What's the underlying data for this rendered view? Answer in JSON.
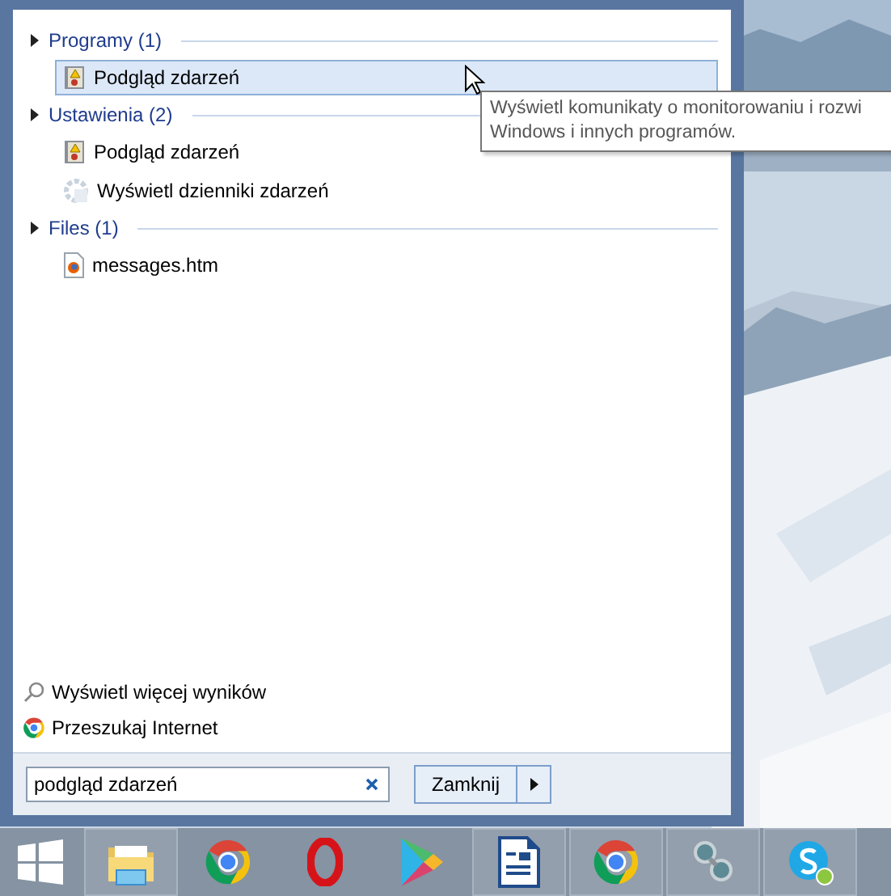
{
  "groups": [
    {
      "title": "Programy (1)",
      "items": [
        {
          "label": "Podgląd zdarzeń",
          "kind": "event-viewer",
          "selected": true
        }
      ]
    },
    {
      "title": "Ustawienia (2)",
      "items": [
        {
          "label": "Podgląd zdarzeń",
          "kind": "event-viewer",
          "selected": false
        },
        {
          "label": "Wyświetl dzienniki zdarzeń",
          "kind": "settings",
          "selected": false
        }
      ]
    },
    {
      "title": "Files (1)",
      "items": [
        {
          "label": "messages.htm",
          "kind": "html-file",
          "selected": false
        }
      ]
    }
  ],
  "tooltip": {
    "lines": [
      "Wyświetl komunikaty o monitorowaniu i rozwi",
      "Windows i innych programów."
    ]
  },
  "links": [
    {
      "label": "Wyświetl więcej wyników",
      "kind": "search"
    },
    {
      "label": "Przeszukaj Internet",
      "kind": "browser"
    }
  ],
  "search": {
    "value": "podgląd zdarzeń"
  },
  "shutdown": {
    "label": "Zamknij"
  },
  "taskbar": [
    {
      "kind": "start",
      "running": false
    },
    {
      "kind": "folder",
      "running": true
    },
    {
      "kind": "browser",
      "running": false
    },
    {
      "kind": "opera",
      "running": false
    },
    {
      "kind": "play",
      "running": false
    },
    {
      "kind": "writer",
      "running": true
    },
    {
      "kind": "browser",
      "running": true
    },
    {
      "kind": "viewer",
      "running": true
    },
    {
      "kind": "chat",
      "running": true
    }
  ]
}
